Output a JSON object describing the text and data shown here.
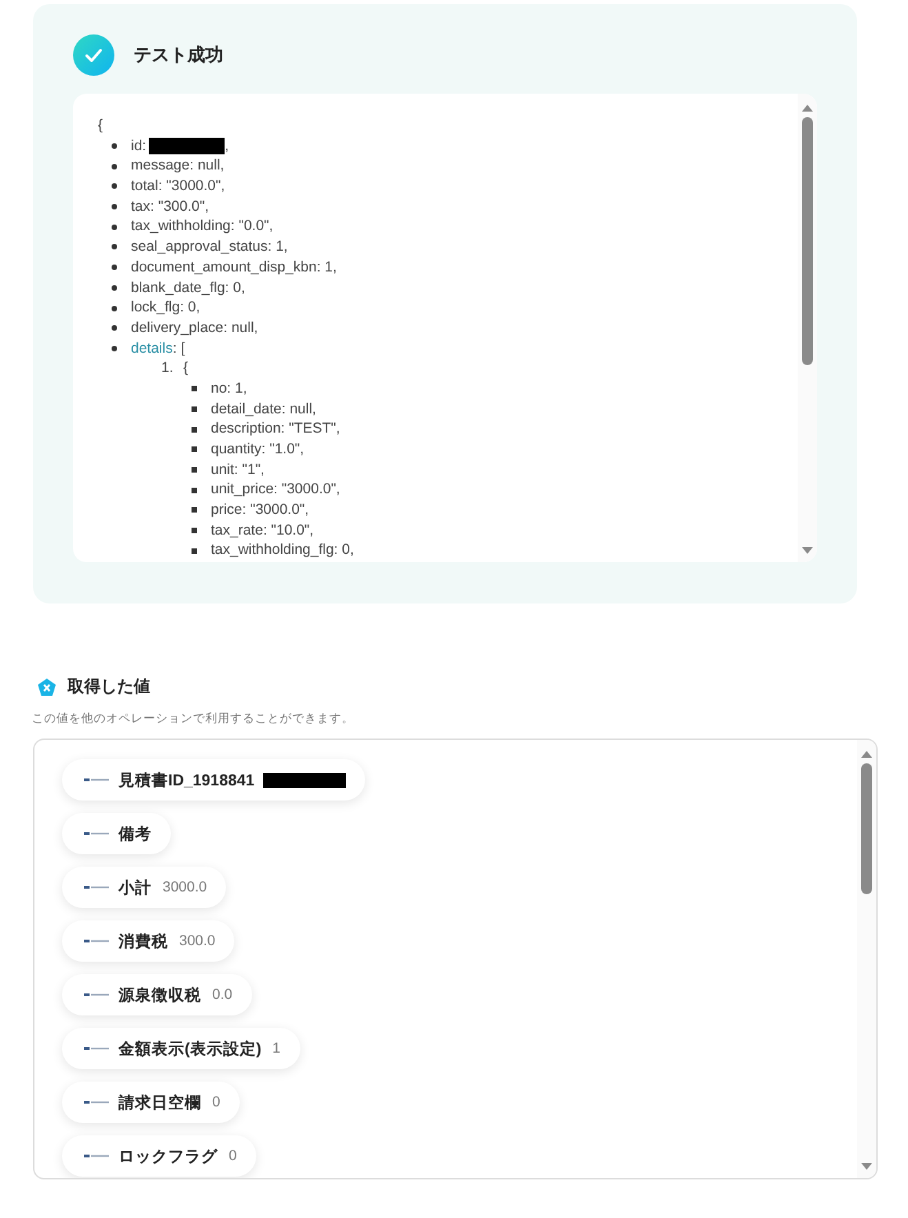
{
  "test_result": {
    "title": "テスト成功",
    "code": {
      "open": "{",
      "items": [
        {
          "text": "id:",
          "redacted": true,
          "after": ","
        },
        {
          "text": "message: null,"
        },
        {
          "text": "total: \"3000.0\","
        },
        {
          "text": "tax: \"300.0\","
        },
        {
          "text": "tax_withholding: \"0.0\","
        },
        {
          "text": "seal_approval_status: 1,"
        },
        {
          "text": "document_amount_disp_kbn: 1,"
        },
        {
          "text": "blank_date_flg: 0,"
        },
        {
          "text": "lock_flg: 0,"
        },
        {
          "text": "delivery_place: null,"
        },
        {
          "link": "details",
          "text": ": [",
          "children": [
            {
              "marker": "1.",
              "text": "{",
              "children": [
                {
                  "text": "no: 1,"
                },
                {
                  "text": "detail_date: null,"
                },
                {
                  "text": "description: \"TEST\","
                },
                {
                  "text": "quantity: \"1.0\","
                },
                {
                  "text": "unit: \"1\","
                },
                {
                  "text": "unit_price: \"3000.0\","
                },
                {
                  "text": "price: \"3000.0\","
                },
                {
                  "text": "tax_rate: \"10.0\","
                },
                {
                  "text": "tax_withholding_flg: 0,"
                }
              ]
            }
          ]
        }
      ]
    }
  },
  "values": {
    "title": "取得した値",
    "description": "この値を他のオペレーションで利用することができます。",
    "chips": [
      {
        "label": "見積書ID_1918841",
        "redacted": true
      },
      {
        "label": "備考"
      },
      {
        "label": "小計",
        "value": "3000.0"
      },
      {
        "label": "消費税",
        "value": "300.0"
      },
      {
        "label": "源泉徴収税",
        "value": "0.0"
      },
      {
        "label": "金額表示(表示設定)",
        "value": "1"
      },
      {
        "label": "請求日空欄",
        "value": "0"
      },
      {
        "label": "ロックフラグ",
        "value": "0"
      }
    ]
  }
}
